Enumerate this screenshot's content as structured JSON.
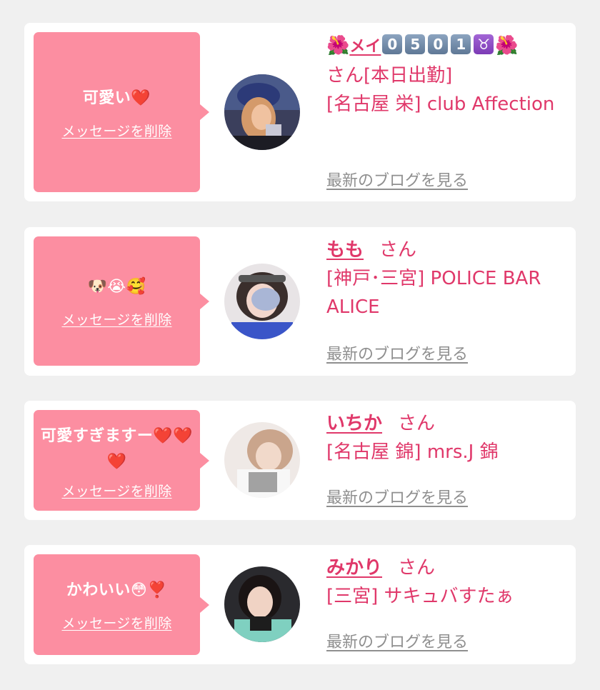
{
  "common": {
    "delete_label": "メッセージを削除",
    "blog_label": "最新のブログを見る",
    "san_label": "さん",
    "accent_color": "#e0386a",
    "bubble_color": "#fc8ea1"
  },
  "cards": [
    {
      "message": "可愛い❤️",
      "name_prefix": "🌺",
      "name": "メイ",
      "name_tags": [
        "0",
        "5",
        "0",
        "1"
      ],
      "name_sign": "♉",
      "name_suffix": "🌺",
      "status": "さん[本日出勤]",
      "shop": "[名古屋 栄] club Affection"
    },
    {
      "message": "🐶😭🥰",
      "name": "もも",
      "shop": "[神戸･三宮] POLICE BAR ALICE"
    },
    {
      "message": "可愛すぎますー❤️❤️❤️",
      "name": "いちか",
      "shop": "[名古屋 錦] mrs.J 錦"
    },
    {
      "message": "かわいい😳❣️",
      "name": "みかり",
      "shop": "[三宮] サキュバすたぁ"
    }
  ]
}
